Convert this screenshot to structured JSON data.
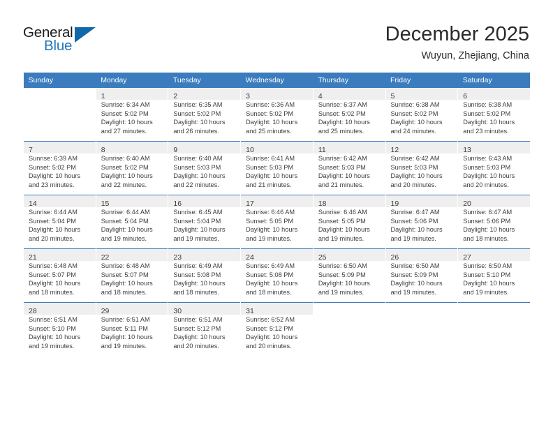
{
  "brand": {
    "word_general": "General",
    "word_blue": "Blue",
    "triangle_color": "#1068a8",
    "blue_color": "#2176bd"
  },
  "header": {
    "title": "December 2025",
    "subtitle": "Wuyun, Zhejiang, China"
  },
  "theme": {
    "header_row_bg": "#3a7cbe",
    "shaded_cell_bg": "#efefef",
    "text_color": "#3c3c3c"
  },
  "labels": {
    "sunrise_prefix": "Sunrise:",
    "sunset_prefix": "Sunset:",
    "daylight_prefix": "Daylight:"
  },
  "day_headers": [
    "Sunday",
    "Monday",
    "Tuesday",
    "Wednesday",
    "Thursday",
    "Friday",
    "Saturday"
  ],
  "weeks": [
    {
      "shaded": true,
      "days": [
        {
          "num": "",
          "lines": []
        },
        {
          "num": "1",
          "lines": [
            "Sunrise: 6:34 AM",
            "Sunset: 5:02 PM",
            "Daylight: 10 hours",
            "and 27 minutes."
          ]
        },
        {
          "num": "2",
          "lines": [
            "Sunrise: 6:35 AM",
            "Sunset: 5:02 PM",
            "Daylight: 10 hours",
            "and 26 minutes."
          ]
        },
        {
          "num": "3",
          "lines": [
            "Sunrise: 6:36 AM",
            "Sunset: 5:02 PM",
            "Daylight: 10 hours",
            "and 25 minutes."
          ]
        },
        {
          "num": "4",
          "lines": [
            "Sunrise: 6:37 AM",
            "Sunset: 5:02 PM",
            "Daylight: 10 hours",
            "and 25 minutes."
          ]
        },
        {
          "num": "5",
          "lines": [
            "Sunrise: 6:38 AM",
            "Sunset: 5:02 PM",
            "Daylight: 10 hours",
            "and 24 minutes."
          ]
        },
        {
          "num": "6",
          "lines": [
            "Sunrise: 6:38 AM",
            "Sunset: 5:02 PM",
            "Daylight: 10 hours",
            "and 23 minutes."
          ]
        }
      ]
    },
    {
      "shaded": true,
      "days": [
        {
          "num": "7",
          "lines": [
            "Sunrise: 6:39 AM",
            "Sunset: 5:02 PM",
            "Daylight: 10 hours",
            "and 23 minutes."
          ]
        },
        {
          "num": "8",
          "lines": [
            "Sunrise: 6:40 AM",
            "Sunset: 5:02 PM",
            "Daylight: 10 hours",
            "and 22 minutes."
          ]
        },
        {
          "num": "9",
          "lines": [
            "Sunrise: 6:40 AM",
            "Sunset: 5:03 PM",
            "Daylight: 10 hours",
            "and 22 minutes."
          ]
        },
        {
          "num": "10",
          "lines": [
            "Sunrise: 6:41 AM",
            "Sunset: 5:03 PM",
            "Daylight: 10 hours",
            "and 21 minutes."
          ]
        },
        {
          "num": "11",
          "lines": [
            "Sunrise: 6:42 AM",
            "Sunset: 5:03 PM",
            "Daylight: 10 hours",
            "and 21 minutes."
          ]
        },
        {
          "num": "12",
          "lines": [
            "Sunrise: 6:42 AM",
            "Sunset: 5:03 PM",
            "Daylight: 10 hours",
            "and 20 minutes."
          ]
        },
        {
          "num": "13",
          "lines": [
            "Sunrise: 6:43 AM",
            "Sunset: 5:03 PM",
            "Daylight: 10 hours",
            "and 20 minutes."
          ]
        }
      ]
    },
    {
      "shaded": true,
      "days": [
        {
          "num": "14",
          "lines": [
            "Sunrise: 6:44 AM",
            "Sunset: 5:04 PM",
            "Daylight: 10 hours",
            "and 20 minutes."
          ]
        },
        {
          "num": "15",
          "lines": [
            "Sunrise: 6:44 AM",
            "Sunset: 5:04 PM",
            "Daylight: 10 hours",
            "and 19 minutes."
          ]
        },
        {
          "num": "16",
          "lines": [
            "Sunrise: 6:45 AM",
            "Sunset: 5:04 PM",
            "Daylight: 10 hours",
            "and 19 minutes."
          ]
        },
        {
          "num": "17",
          "lines": [
            "Sunrise: 6:46 AM",
            "Sunset: 5:05 PM",
            "Daylight: 10 hours",
            "and 19 minutes."
          ]
        },
        {
          "num": "18",
          "lines": [
            "Sunrise: 6:46 AM",
            "Sunset: 5:05 PM",
            "Daylight: 10 hours",
            "and 19 minutes."
          ]
        },
        {
          "num": "19",
          "lines": [
            "Sunrise: 6:47 AM",
            "Sunset: 5:06 PM",
            "Daylight: 10 hours",
            "and 19 minutes."
          ]
        },
        {
          "num": "20",
          "lines": [
            "Sunrise: 6:47 AM",
            "Sunset: 5:06 PM",
            "Daylight: 10 hours",
            "and 18 minutes."
          ]
        }
      ]
    },
    {
      "shaded": true,
      "days": [
        {
          "num": "21",
          "lines": [
            "Sunrise: 6:48 AM",
            "Sunset: 5:07 PM",
            "Daylight: 10 hours",
            "and 18 minutes."
          ]
        },
        {
          "num": "22",
          "lines": [
            "Sunrise: 6:48 AM",
            "Sunset: 5:07 PM",
            "Daylight: 10 hours",
            "and 18 minutes."
          ]
        },
        {
          "num": "23",
          "lines": [
            "Sunrise: 6:49 AM",
            "Sunset: 5:08 PM",
            "Daylight: 10 hours",
            "and 18 minutes."
          ]
        },
        {
          "num": "24",
          "lines": [
            "Sunrise: 6:49 AM",
            "Sunset: 5:08 PM",
            "Daylight: 10 hours",
            "and 18 minutes."
          ]
        },
        {
          "num": "25",
          "lines": [
            "Sunrise: 6:50 AM",
            "Sunset: 5:09 PM",
            "Daylight: 10 hours",
            "and 19 minutes."
          ]
        },
        {
          "num": "26",
          "lines": [
            "Sunrise: 6:50 AM",
            "Sunset: 5:09 PM",
            "Daylight: 10 hours",
            "and 19 minutes."
          ]
        },
        {
          "num": "27",
          "lines": [
            "Sunrise: 6:50 AM",
            "Sunset: 5:10 PM",
            "Daylight: 10 hours",
            "and 19 minutes."
          ]
        }
      ]
    },
    {
      "shaded": true,
      "days": [
        {
          "num": "28",
          "lines": [
            "Sunrise: 6:51 AM",
            "Sunset: 5:10 PM",
            "Daylight: 10 hours",
            "and 19 minutes."
          ]
        },
        {
          "num": "29",
          "lines": [
            "Sunrise: 6:51 AM",
            "Sunset: 5:11 PM",
            "Daylight: 10 hours",
            "and 19 minutes."
          ]
        },
        {
          "num": "30",
          "lines": [
            "Sunrise: 6:51 AM",
            "Sunset: 5:12 PM",
            "Daylight: 10 hours",
            "and 20 minutes."
          ]
        },
        {
          "num": "31",
          "lines": [
            "Sunrise: 6:52 AM",
            "Sunset: 5:12 PM",
            "Daylight: 10 hours",
            "and 20 minutes."
          ]
        },
        {
          "num": "",
          "lines": []
        },
        {
          "num": "",
          "lines": []
        },
        {
          "num": "",
          "lines": []
        }
      ]
    }
  ]
}
